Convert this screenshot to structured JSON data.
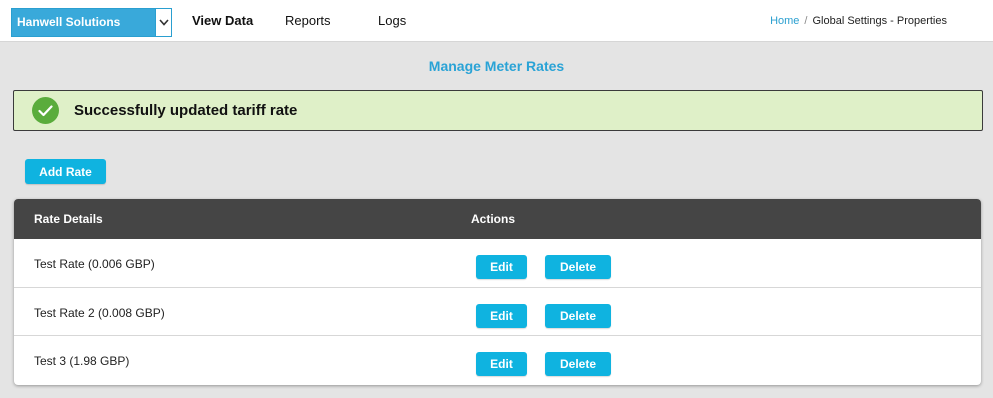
{
  "header": {
    "company_select": {
      "value": "Hanwell Solutions"
    },
    "nav": [
      {
        "label": "View Data",
        "active": true
      },
      {
        "label": "Reports",
        "active": false
      },
      {
        "label": "Logs",
        "active": false
      }
    ],
    "breadcrumb": {
      "home": "Home",
      "separator": "/",
      "current": "Global Settings - Properties"
    }
  },
  "page": {
    "title": "Manage Meter Rates",
    "alert": {
      "message": "Successfully updated tariff rate",
      "icon": "check-circle-icon",
      "color": "#5aac3c"
    },
    "add_button": "Add Rate"
  },
  "table": {
    "columns": [
      "Rate Details",
      "Actions"
    ],
    "rows": [
      {
        "details": "Test Rate (0.006 GBP)",
        "edit": "Edit",
        "delete": "Delete"
      },
      {
        "details": "Test Rate 2 (0.008 GBP)",
        "edit": "Edit",
        "delete": "Delete"
      },
      {
        "details": "Test 3 (1.98 GBP)",
        "edit": "Edit",
        "delete": "Delete"
      }
    ]
  },
  "colors": {
    "accent": "#0fb3e0",
    "header_bg": "#454545",
    "alert_bg": "#dff0c8",
    "title": "#2aa3d6"
  }
}
